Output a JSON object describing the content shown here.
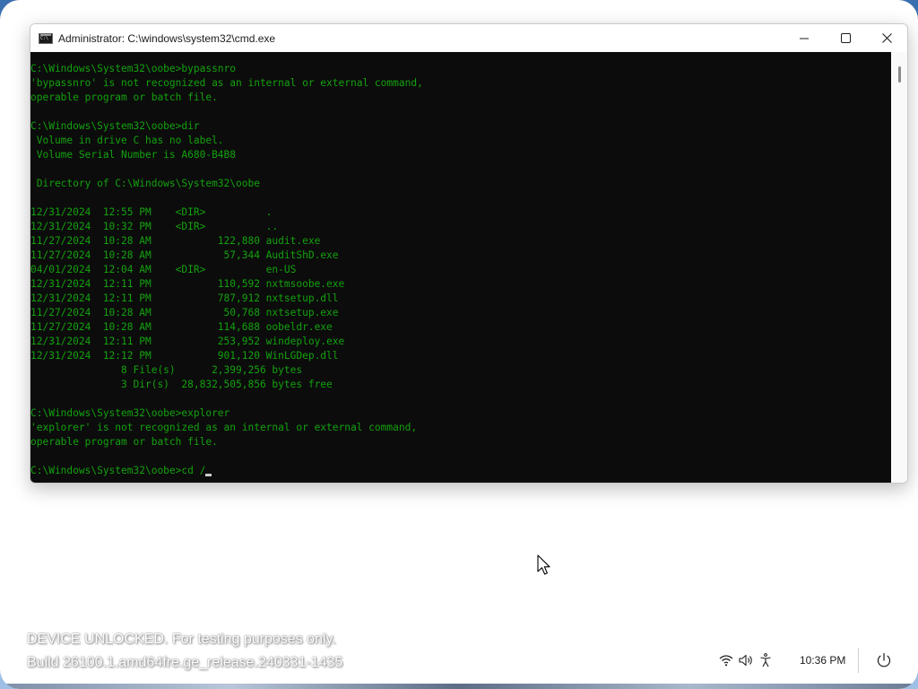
{
  "window": {
    "title": "Administrator: C:\\windows\\system32\\cmd.exe",
    "controls": {
      "minimize_icon": "minimize-icon",
      "maximize_icon": "maximize-icon",
      "close_icon": "close-icon"
    }
  },
  "console": {
    "text_color": "#13a10e",
    "background": "#0c0c0c",
    "lines": [
      "C:\\Windows\\System32\\oobe>bypassnro",
      "'bypassnro' is not recognized as an internal or external command,",
      "operable program or batch file.",
      "",
      "C:\\Windows\\System32\\oobe>dir",
      " Volume in drive C has no label.",
      " Volume Serial Number is A680-B4B8",
      "",
      " Directory of C:\\Windows\\System32\\oobe",
      "",
      "12/31/2024  12:55 PM    <DIR>          .",
      "12/31/2024  10:32 PM    <DIR>          ..",
      "11/27/2024  10:28 AM           122,880 audit.exe",
      "11/27/2024  10:28 AM            57,344 AuditShD.exe",
      "04/01/2024  12:04 AM    <DIR>          en-US",
      "12/31/2024  12:11 PM           110,592 nxtmsoobe.exe",
      "12/31/2024  12:11 PM           787,912 nxtsetup.dll",
      "11/27/2024  10:28 AM            50,768 nxtsetup.exe",
      "11/27/2024  10:28 AM           114,688 oobeldr.exe",
      "12/31/2024  12:11 PM           253,952 windeploy.exe",
      "12/31/2024  12:12 PM           901,120 WinLGDep.dll",
      "               8 File(s)      2,399,256 bytes",
      "               3 Dir(s)  28,832,505,856 bytes free",
      "",
      "C:\\Windows\\System32\\oobe>explorer",
      "'explorer' is not recognized as an internal or external command,",
      "operable program or batch file.",
      "",
      "C:\\Windows\\System32\\oobe>cd /"
    ]
  },
  "watermark": {
    "line1": "DEVICE UNLOCKED. For testing purposes only.",
    "line2": "Build 26100.1.amd64fre.ge_release.240331-1435"
  },
  "tray": {
    "icons": [
      "wifi-icon",
      "volume-icon",
      "accessibility-icon"
    ],
    "clock": "10:36 PM",
    "power_icon": "power-icon"
  }
}
